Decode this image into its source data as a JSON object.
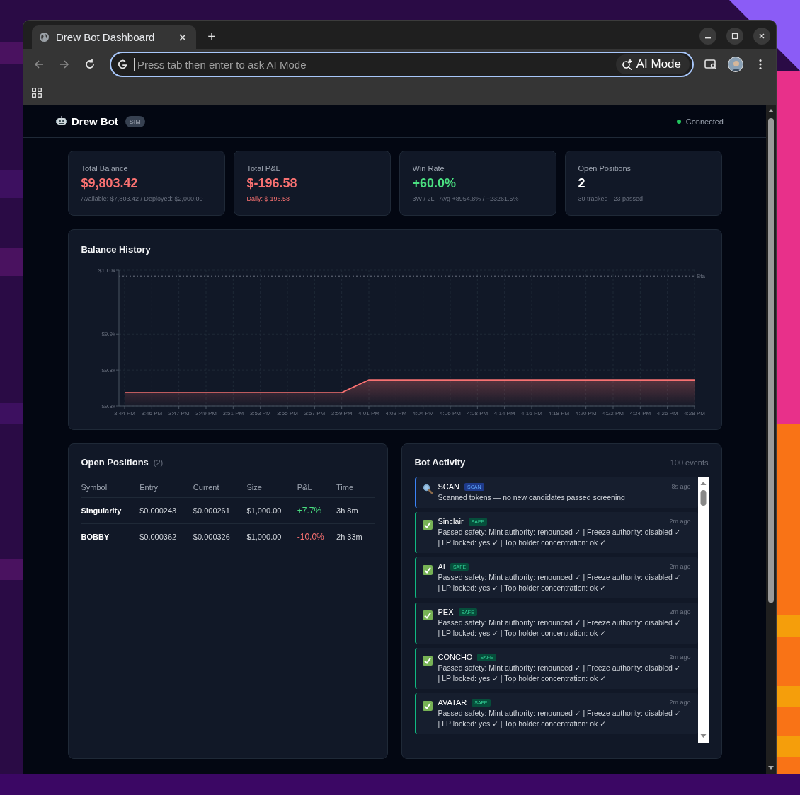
{
  "browser": {
    "tab_title": "Drew Bot Dashboard",
    "new_tab": "+",
    "omnibox_placeholder": "Press tab then enter to ask AI Mode",
    "ai_mode": "AI Mode"
  },
  "header": {
    "brand": "Drew Bot",
    "badge": "SIM",
    "status": "Connected",
    "connected": true
  },
  "stats": [
    {
      "label": "Total Balance",
      "value": "$9,803.42",
      "color": "#f87171",
      "sub": "Available: $7,803.42 / Deployed: $2,000.00",
      "sub_highlight": false
    },
    {
      "label": "Total P&L",
      "value": "$-196.58",
      "color": "#f87171",
      "sub": "Daily: $-196.58",
      "sub_highlight": true
    },
    {
      "label": "Win Rate",
      "value": "+60.0%",
      "color": "#4ade80",
      "sub": "3W / 2L · Avg +8954.8% / −23261.5%",
      "sub_highlight": false
    },
    {
      "label": "Open Positions",
      "value": "2",
      "color": "#ffffff",
      "sub": "30 tracked · 23 passed",
      "sub_highlight": false
    }
  ],
  "balance_history": {
    "title": "Balance History",
    "chart_data": {
      "type": "area",
      "categories": [
        "3:44 PM",
        "3:46 PM",
        "3:47 PM",
        "3:49 PM",
        "3:51 PM",
        "3:53 PM",
        "3:55 PM",
        "3:57 PM",
        "3:59 PM",
        "4:01 PM",
        "4:03 PM",
        "4:04 PM",
        "4:06 PM",
        "4:08 PM",
        "4:14 PM",
        "4:16 PM",
        "4:18 PM",
        "4:20 PM",
        "4:22 PM",
        "4:24 PM",
        "4:26 PM",
        "4:28 PM"
      ],
      "grid": true,
      "series": [
        {
          "color": "#f87171",
          "values": [
            9799,
            9799,
            9799,
            9799,
            9799,
            9799,
            9799,
            9799,
            9799,
            9821,
            9821,
            9821,
            9821,
            9821,
            9821,
            9821,
            9821,
            9821,
            9821,
            9821,
            9821,
            9821
          ]
        }
      ],
      "ylim": [
        9776,
        10010
      ],
      "yticks": [
        {
          "value": 10010,
          "label": "$10.0k"
        },
        {
          "value": 9900,
          "label": "$9.9k"
        },
        {
          "value": 9838,
          "label": "$9.8k"
        },
        {
          "value": 9776,
          "label": "$9.8k"
        }
      ],
      "ref_lines": [
        {
          "axis": "y",
          "value": 10000,
          "label": "Sta"
        }
      ]
    }
  },
  "positions": {
    "title": "Open Positions",
    "count": "(2)",
    "columns": [
      "Symbol",
      "Entry",
      "Current",
      "Size",
      "P&L",
      "Time"
    ],
    "rows": [
      {
        "symbol": "Singularity",
        "entry": "$0.000243",
        "current": "$0.000261",
        "size": "$1,000.00",
        "pnl": "+7.7%",
        "color": "#4ade80",
        "time": "3h 8m"
      },
      {
        "symbol": "BOBBY",
        "entry": "$0.000362",
        "current": "$0.000326",
        "size": "$1,000.00",
        "pnl": "-10.0%",
        "color": "#f87171",
        "time": "2h 33m"
      }
    ]
  },
  "activity": {
    "title": "Bot Activity",
    "count": "100 events",
    "events": [
      {
        "kind": "scan",
        "title": "SCAN",
        "badge": "SCAN",
        "time": "8s ago",
        "message": "Scanned tokens — no new candidates passed screening"
      },
      {
        "kind": "safe",
        "title": "Sinclair",
        "badge": "SAFE",
        "time": "2m ago",
        "message": "Passed safety: Mint authority: renounced ✓ | Freeze authority: disabled ✓ | LP locked: yes ✓ | Top holder concentration: ok ✓"
      },
      {
        "kind": "safe",
        "title": "AI",
        "badge": "SAFE",
        "time": "2m ago",
        "message": "Passed safety: Mint authority: renounced ✓ | Freeze authority: disabled ✓ | LP locked: yes ✓ | Top holder concentration: ok ✓"
      },
      {
        "kind": "safe",
        "title": "PEX",
        "badge": "SAFE",
        "time": "2m ago",
        "message": "Passed safety: Mint authority: renounced ✓ | Freeze authority: disabled ✓ | LP locked: yes ✓ | Top holder concentration: ok ✓"
      },
      {
        "kind": "safe",
        "title": "CONCHO",
        "badge": "SAFE",
        "time": "2m ago",
        "message": "Passed safety: Mint authority: renounced ✓ | Freeze authority: disabled ✓ | LP locked: yes ✓ | Top holder concentration: ok ✓"
      },
      {
        "kind": "safe",
        "title": "AVATAR",
        "badge": "SAFE",
        "time": "2m ago",
        "message": "Passed safety: Mint authority: renounced ✓ | Freeze authority: disabled ✓ | LP locked: yes ✓ | Top holder concentration: ok ✓"
      }
    ]
  }
}
